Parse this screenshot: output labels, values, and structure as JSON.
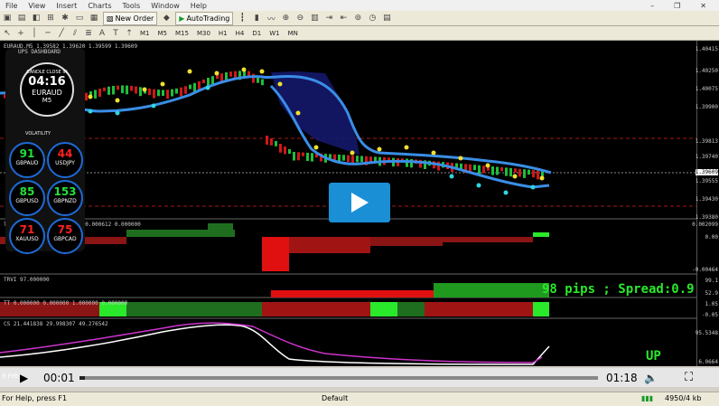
{
  "menu": {
    "items": [
      "File",
      "View",
      "Insert",
      "Charts",
      "Tools",
      "Window",
      "Help"
    ]
  },
  "toolbar": {
    "new_order": "New Order",
    "autotrading": "AutoTrading",
    "timeframes": [
      "M1",
      "M5",
      "M15",
      "M30",
      "H1",
      "H4",
      "D1",
      "W1",
      "MN"
    ]
  },
  "chart": {
    "title": "EURAUD,M5 1.39582 1.39620 1.39599 1.39609",
    "price_labels": [
      "1.40415",
      "1.40250",
      "1.40075",
      "1.39900",
      "1.39813",
      "1.39740",
      "1.39609",
      "1.39555",
      "1.39430",
      "1.39380"
    ],
    "accent_line_color": "#cc2222"
  },
  "widget": {
    "header": "UPS DASHBOARD",
    "clock_label": "CANDLE CLOSE IN",
    "clock_time": "04:16",
    "symbol": "EURAUD",
    "timeframe": "M5",
    "volatility_label": "VOLATILITY",
    "pairs": [
      {
        "value": "91",
        "name": "GBPAUD",
        "color": "green"
      },
      {
        "value": "44",
        "name": "USDJPY",
        "color": "red"
      },
      {
        "value": "85",
        "name": "GBPUSD",
        "color": "green"
      },
      {
        "value": "153",
        "name": "GBPNZD",
        "color": "green"
      },
      {
        "value": "71",
        "name": "XAUUSD",
        "color": "red"
      },
      {
        "value": "75",
        "name": "GBPCAD",
        "color": "red"
      }
    ]
  },
  "indicators": {
    "trwave": {
      "label": "TRWave 0.000000 0.000000 0.000612 0.000000",
      "scale_top": "0.002099",
      "scale_mid": "0.00",
      "scale_bot": "-0.00464"
    },
    "trv": {
      "label": "TRVI 97.000000",
      "scale_top": "99.1",
      "scale_mid": "52.9"
    },
    "tt": {
      "label": "TT 0.000000 0.000000 1.000000 0.000000",
      "scale_top": "1.05",
      "scale_bot": "-0.05"
    },
    "cs": {
      "label": "CS 21.441838 29.998307 49.276542",
      "scale_top": "95.5348",
      "scale_bot": "6.0664"
    }
  },
  "overlay": {
    "pips": "98 pips ; Spread:0.9",
    "signal": "UP"
  },
  "player": {
    "current_time": "00:01",
    "total_time": "01:18",
    "progress": 0.01
  },
  "bottom_tab": "9 Feb",
  "status": {
    "help": "For Help, press F1",
    "profile": "Default",
    "traffic": "4950/4 kb"
  }
}
